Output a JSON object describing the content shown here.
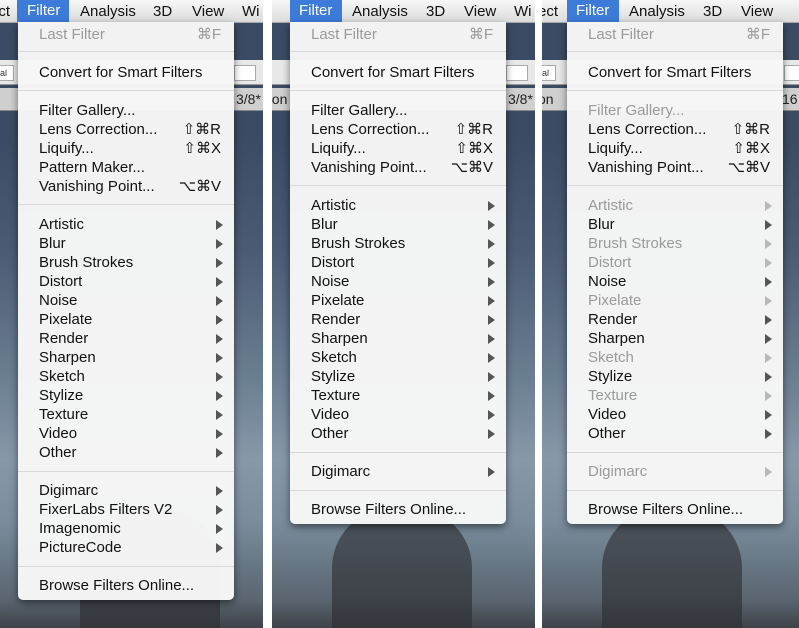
{
  "menubar": {
    "filter": "Filter",
    "analysis": "Analysis",
    "three_d": "3D",
    "view": "View",
    "window_partial": "Wi",
    "left_partial": "ect"
  },
  "optionsbar": {
    "field_partial": "nal"
  },
  "doc_tabs": {
    "p1": "3/8*",
    "p2_left": "non",
    "p2_right": "3/8*",
    "p3_left": "on",
    "p3_right": "16"
  },
  "panels": [
    {
      "items": [
        {
          "label": "Last Filter",
          "shortcut": "⌘F",
          "disabled": true
        },
        {
          "label": "Convert for Smart Filters"
        },
        {
          "label": "Filter Gallery..."
        },
        {
          "label": "Lens Correction...",
          "shortcut": "⇧⌘R"
        },
        {
          "label": "Liquify...",
          "shortcut": "⇧⌘X"
        },
        {
          "label": "Pattern Maker..."
        },
        {
          "label": "Vanishing Point...",
          "shortcut": "⌥⌘V"
        },
        {
          "label": "Artistic",
          "sub": true
        },
        {
          "label": "Blur",
          "sub": true
        },
        {
          "label": "Brush Strokes",
          "sub": true
        },
        {
          "label": "Distort",
          "sub": true
        },
        {
          "label": "Noise",
          "sub": true
        },
        {
          "label": "Pixelate",
          "sub": true
        },
        {
          "label": "Render",
          "sub": true
        },
        {
          "label": "Sharpen",
          "sub": true
        },
        {
          "label": "Sketch",
          "sub": true
        },
        {
          "label": "Stylize",
          "sub": true
        },
        {
          "label": "Texture",
          "sub": true
        },
        {
          "label": "Video",
          "sub": true
        },
        {
          "label": "Other",
          "sub": true
        },
        {
          "label": "Digimarc",
          "sub": true
        },
        {
          "label": "FixerLabs Filters V2",
          "sub": true
        },
        {
          "label": "Imagenomic",
          "sub": true
        },
        {
          "label": "PictureCode",
          "sub": true
        },
        {
          "label": "Browse Filters Online..."
        }
      ]
    },
    {
      "items": [
        {
          "label": "Last Filter",
          "shortcut": "⌘F",
          "disabled": true
        },
        {
          "label": "Convert for Smart Filters"
        },
        {
          "label": "Filter Gallery..."
        },
        {
          "label": "Lens Correction...",
          "shortcut": "⇧⌘R"
        },
        {
          "label": "Liquify...",
          "shortcut": "⇧⌘X"
        },
        {
          "label": "Vanishing Point...",
          "shortcut": "⌥⌘V"
        },
        {
          "label": "Artistic",
          "sub": true
        },
        {
          "label": "Blur",
          "sub": true
        },
        {
          "label": "Brush Strokes",
          "sub": true
        },
        {
          "label": "Distort",
          "sub": true
        },
        {
          "label": "Noise",
          "sub": true
        },
        {
          "label": "Pixelate",
          "sub": true
        },
        {
          "label": "Render",
          "sub": true
        },
        {
          "label": "Sharpen",
          "sub": true
        },
        {
          "label": "Sketch",
          "sub": true
        },
        {
          "label": "Stylize",
          "sub": true
        },
        {
          "label": "Texture",
          "sub": true
        },
        {
          "label": "Video",
          "sub": true
        },
        {
          "label": "Other",
          "sub": true
        },
        {
          "label": "Digimarc",
          "sub": true
        },
        {
          "label": "Browse Filters Online..."
        }
      ]
    },
    {
      "items": [
        {
          "label": "Last Filter",
          "shortcut": "⌘F",
          "disabled": true
        },
        {
          "label": "Convert for Smart Filters"
        },
        {
          "label": "Filter Gallery...",
          "disabled": true
        },
        {
          "label": "Lens Correction...",
          "shortcut": "⇧⌘R"
        },
        {
          "label": "Liquify...",
          "shortcut": "⇧⌘X"
        },
        {
          "label": "Vanishing Point...",
          "shortcut": "⌥⌘V"
        },
        {
          "label": "Artistic",
          "sub": true,
          "disabled": true
        },
        {
          "label": "Blur",
          "sub": true
        },
        {
          "label": "Brush Strokes",
          "sub": true,
          "disabled": true
        },
        {
          "label": "Distort",
          "sub": true,
          "disabled": true
        },
        {
          "label": "Noise",
          "sub": true
        },
        {
          "label": "Pixelate",
          "sub": true,
          "disabled": true
        },
        {
          "label": "Render",
          "sub": true
        },
        {
          "label": "Sharpen",
          "sub": true
        },
        {
          "label": "Sketch",
          "sub": true,
          "disabled": true
        },
        {
          "label": "Stylize",
          "sub": true
        },
        {
          "label": "Texture",
          "sub": true,
          "disabled": true
        },
        {
          "label": "Video",
          "sub": true
        },
        {
          "label": "Other",
          "sub": true
        },
        {
          "label": "Digimarc",
          "sub": true,
          "disabled": true
        },
        {
          "label": "Browse Filters Online..."
        }
      ]
    }
  ],
  "colors": {
    "menu_highlight": "#3d7bd9",
    "disabled_text": "#9a9a9a"
  }
}
